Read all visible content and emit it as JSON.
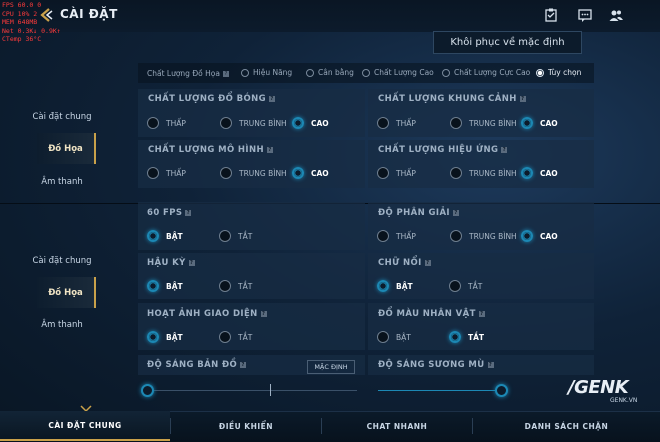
{
  "overlay": {
    "lines": [
      "FPS  60.0  0",
      "CPU  10%  2",
      "MEM 648MB",
      "Net    0.3K↓  0.9K↑",
      "CTemp  36°C"
    ]
  },
  "header": {
    "title": "CÀI ĐẶT",
    "restore_label": "Khôi phục về mặc định"
  },
  "quality": {
    "label": "Chất Lượng Đồ Họa",
    "options": [
      "Hiệu Năng",
      "Cân bằng",
      "Chất Lượng Cao",
      "Chất Lượng Cực Cao",
      "Tùy chọn"
    ],
    "selected": "Tùy chọn"
  },
  "sidebar_top": {
    "items": [
      "Cài đặt chung",
      "Đồ Họa",
      "Âm thanh"
    ],
    "active": "Đồ Họa"
  },
  "sidebar_bottom": {
    "items": [
      "Cài đặt chung",
      "Đồ Họa",
      "Âm thanh"
    ],
    "active": "Đồ Họa"
  },
  "panels": {
    "shadow": {
      "title": "CHẤT LƯỢNG ĐỔ BÓNG",
      "options": [
        "THẤP",
        "TRUNG BÌNH",
        "CAO"
      ],
      "selected": "CAO"
    },
    "frame": {
      "title": "CHẤT LƯỢNG KHUNG CẢNH",
      "options": [
        "THẤP",
        "TRUNG BÌNH",
        "CAO"
      ],
      "selected": "CAO"
    },
    "model": {
      "title": "CHẤT LƯỢNG MÔ HÌNH",
      "options": [
        "THẤP",
        "TRUNG BÌNH",
        "CAO"
      ],
      "selected": "CAO"
    },
    "effect": {
      "title": "CHẤT LƯỢNG HIỆU ỨNG",
      "options": [
        "THẤP",
        "TRUNG BÌNH",
        "CAO"
      ],
      "selected": "CAO"
    },
    "fps60": {
      "title": "60 FPS",
      "options": [
        "BẬT",
        "TẮT"
      ],
      "selected": "BẬT"
    },
    "resolution": {
      "title": "ĐỘ PHÂN GIẢI",
      "options": [
        "THẤP",
        "TRUNG BÌNH",
        "CAO"
      ],
      "selected": "CAO"
    },
    "postfx": {
      "title": "HẬU KỲ",
      "options": [
        "BẬT",
        "TẮT"
      ],
      "selected": "BẬT"
    },
    "floattext": {
      "title": "CHỮ NỔI",
      "options": [
        "BẬT",
        "TẮT"
      ],
      "selected": "BẬT"
    },
    "uianim": {
      "title": "HOẠT ẢNH GIAO DIỆN",
      "options": [
        "BẬT",
        "TẮT"
      ],
      "selected": "BẬT"
    },
    "charcolor": {
      "title": "ĐỔ MÀU NHÂN VẬT",
      "options": [
        "BẬT",
        "TẮT"
      ],
      "selected": "TẮT"
    }
  },
  "sliders": {
    "map_brightness": {
      "title": "ĐỘ SÁNG BẢN ĐỒ",
      "default_label": "MẶC ĐỊNH",
      "value": 0.0
    },
    "fog_brightness": {
      "title": "ĐỘ SÁNG SƯƠNG MÙ",
      "value": 1.0
    }
  },
  "bottom_nav": {
    "tabs": [
      "CÀI ĐẶT CHUNG",
      "ĐIỀU KHIỂN",
      "CHAT NHANH",
      "DANH SÁCH CHẶN"
    ],
    "active": "CÀI ĐẶT CHUNG"
  },
  "watermark": {
    "logo": "/GENK",
    "site": "GENK.VN"
  },
  "colors": {
    "accent": "#1c88b4",
    "gold": "#c9a14a",
    "overlay_text": "#ff3b3b"
  }
}
